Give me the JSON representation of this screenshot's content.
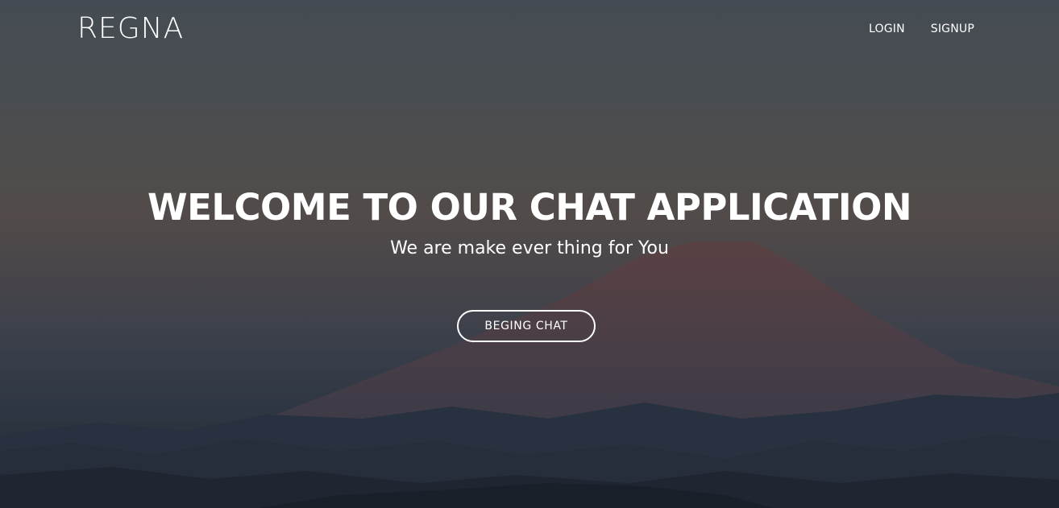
{
  "header": {
    "logo": "REGNA",
    "nav": {
      "login": "LOGIN",
      "signup": "SIGNUP"
    }
  },
  "hero": {
    "title": "WELCOME TO OUR CHAT APPLICATION",
    "subtitle": "We are make ever thing for You",
    "cta_label": "BEGING CHAT"
  },
  "colors": {
    "text": "#ffffff",
    "sky_top": "#4f575e",
    "horizon": "#5f5754",
    "ground": "#252d3a"
  }
}
